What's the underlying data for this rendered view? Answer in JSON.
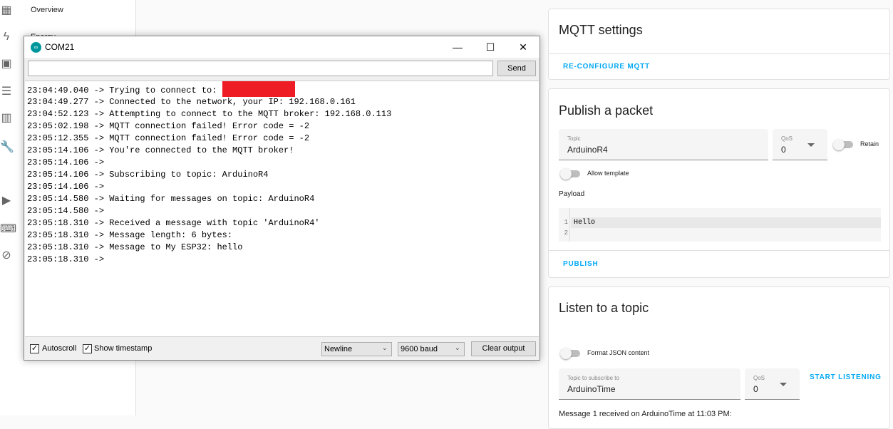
{
  "sidebar": {
    "items": [
      {
        "label": "Overview",
        "icon": "dashboard-icon"
      },
      {
        "label": "Energy",
        "icon": "lightning-icon"
      }
    ],
    "icons": [
      "dashboard-icon",
      "lightning-icon",
      "person-badge-icon",
      "list-icon",
      "chart-icon",
      "wrench-icon",
      "media-icon",
      "terminal-icon",
      "compass-icon"
    ]
  },
  "serial": {
    "title": "COM21",
    "input_value": "",
    "send": "Send",
    "lines": [
      "23:04:49.040 -> Trying to connect to: ",
      "23:04:49.277 -> Connected to the network, your IP: 192.168.0.161",
      "23:04:52.123 -> Attempting to connect to the MQTT broker: 192.168.0.113",
      "23:05:02.198 -> MQTT connection failed! Error code = -2",
      "23:05:12.355 -> MQTT connection failed! Error code = -2",
      "23:05:14.106 -> You're connected to the MQTT broker!",
      "23:05:14.106 -> ",
      "23:05:14.106 -> Subscribing to topic: ArduinoR4",
      "23:05:14.106 -> ",
      "23:05:14.580 -> Waiting for messages on topic: ArduinoR4",
      "23:05:14.580 -> ",
      "23:05:18.310 -> Received a message with topic 'ArduinoR4'",
      "23:05:18.310 -> Message length: 6 bytes:",
      "23:05:18.310 -> Message to My ESP32: hello",
      "23:05:18.310 -> "
    ],
    "autoscroll": "Autoscroll",
    "show_timestamp": "Show timestamp",
    "line_ending": "Newline",
    "baud": "9600 baud",
    "clear": "Clear output",
    "redaction_color": "#ee1c25"
  },
  "mqtt": {
    "title": "MQTT settings",
    "reconfigure": "RE-CONFIGURE MQTT"
  },
  "publish": {
    "title": "Publish a packet",
    "topic_label": "Topic",
    "topic": "ArduinoR4",
    "qos_label": "QoS",
    "qos": "0",
    "retain": "Retain",
    "allow_template": "Allow template",
    "payload_label": "Payload",
    "payload_lines": [
      "Hello",
      ""
    ],
    "line_numbers": [
      "1",
      "2"
    ],
    "publish": "PUBLISH"
  },
  "listen": {
    "title": "Listen to a topic",
    "format_json": "Format JSON content",
    "topic_label": "Topic to subscribe to",
    "topic": "ArduinoTime",
    "qos_label": "QoS",
    "qos": "0",
    "start": "START LISTENING",
    "message": "Message 1 received on ArduinoTime at 11:03 PM:"
  },
  "accent": "#03a9f4"
}
